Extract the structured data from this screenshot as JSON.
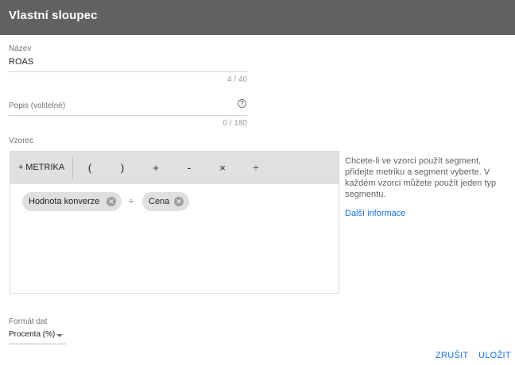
{
  "dialog": {
    "title": "Vlastní sloupec"
  },
  "name_field": {
    "label": "Název",
    "value": "ROAS",
    "counter": "4 / 40"
  },
  "description_field": {
    "placeholder": "Popis (volitelné)",
    "counter": "0 / 180",
    "help_icon": "help-circle-icon"
  },
  "formula": {
    "label": "Vzorec",
    "toolbar": {
      "metric_label": "+ METRIKA",
      "open_paren": "(",
      "close_paren": ")",
      "plus": "+",
      "minus": "-",
      "multiply": "×",
      "divide": "÷"
    },
    "chips": [
      {
        "label": "Hodnota konverze",
        "remove_icon": "close-circle-icon"
      },
      {
        "label": "Cena",
        "remove_icon": "close-circle-icon"
      }
    ],
    "operator": "÷"
  },
  "hint": {
    "text": "Chcete-li ve vzorci použít segment, přidejte metriku a segment vyberte. V každém vzorci můžete použít jeden typ segmentu.",
    "link": "Další informace"
  },
  "format": {
    "label": "Formát dat",
    "value": "Procenta (%)",
    "icon": "dropdown-arrow-icon"
  },
  "actions": {
    "cancel": "ZRUŠIT",
    "save": "ULOŽIT"
  },
  "colors": {
    "header": "#616161",
    "accent": "#1a73e8",
    "toolbar": "#e0e0e0",
    "chip": "#e0e0e0"
  }
}
